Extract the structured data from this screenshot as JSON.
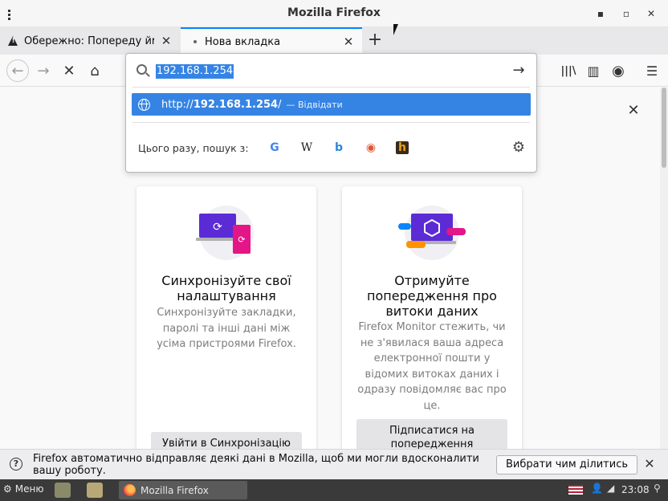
{
  "window": {
    "title": "Mozilla Firefox",
    "minimize": "▪",
    "maximize": "▫",
    "close": "✕"
  },
  "tabs": [
    {
      "label": "Обережно: Попереду ймо",
      "close": "✕"
    },
    {
      "label": "Нова вкладка",
      "close": "✕"
    }
  ],
  "newtab": "+",
  "nav": {
    "back": "←",
    "forward": "→",
    "stop": "✕",
    "home": "⌂",
    "library": "|||\\",
    "sidebar": "▥",
    "account": "◉",
    "menu": "☰"
  },
  "urlbar": {
    "value": "192.168.1.254",
    "go": "→",
    "suggestion": {
      "prefix": "http://",
      "host": "192.168.1.254",
      "suffix": "/",
      "action": "— Відвідати"
    },
    "oneoff_label": "Цього разу, пошук з:",
    "engines": [
      {
        "name": "google-icon",
        "glyph": "G",
        "color": "#4285f4"
      },
      {
        "name": "wikipedia-icon",
        "glyph": "W",
        "color": "#222222"
      },
      {
        "name": "bing-icon",
        "glyph": "b",
        "color": "#2b88d9"
      },
      {
        "name": "duckduckgo-icon",
        "glyph": "◉",
        "color": "#de5833"
      },
      {
        "name": "hotline-icon",
        "glyph": "h",
        "color": "#e8a317"
      }
    ],
    "settings": "⚙"
  },
  "content": {
    "dismiss": "✕",
    "cards": [
      {
        "heading": "Синхронізуйте свої налаштування",
        "desc": "Синхронізуйте закладки, паролі та інші дані між усіма пристроями Firefox.",
        "cta": "Увійти в Синхронізацію"
      },
      {
        "heading": "Отримуйте попередження про витоки даних",
        "desc": "Firefox Monitor стежить, чи не з'явилася ваша адреса електронної пошти у відомих витоках даних і одразу повідомляє вас про це.",
        "cta": "Підписатися на попередження"
      }
    ]
  },
  "notification": {
    "icon": "?",
    "message": "Firefox автоматично відправляє деякі дані в Mozilla, щоб ми могли вдосконалити вашу роботу.",
    "button": "Вибрати чим ділитись",
    "close": "✕"
  },
  "taskbar": {
    "menu_icon": "⚙",
    "menu_label": "Меню",
    "task_label": "Mozilla Firefox",
    "clock": "23:08"
  }
}
